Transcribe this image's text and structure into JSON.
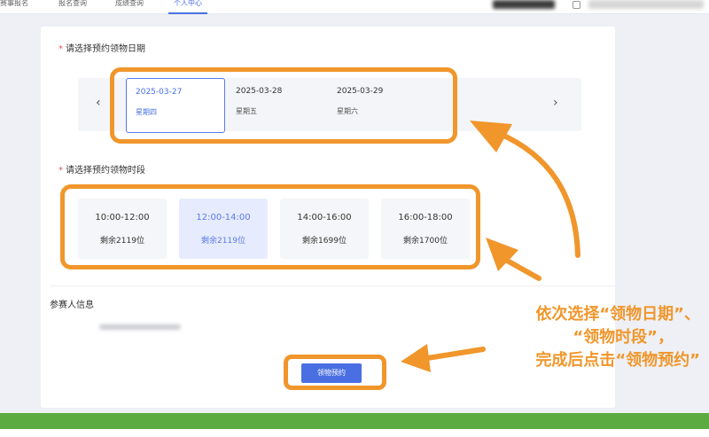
{
  "nav": {
    "tabs": [
      "赛事报名",
      "报名查询",
      "成绩查询",
      "个人中心"
    ],
    "active_index": 3
  },
  "date_section": {
    "label": "请选择预约领物日期",
    "dates": [
      {
        "date": "2025-03-27",
        "weekday": "星期四",
        "selected": true
      },
      {
        "date": "2025-03-28",
        "weekday": "星期五",
        "selected": false
      },
      {
        "date": "2025-03-29",
        "weekday": "星期六",
        "selected": false
      }
    ],
    "prev": "‹",
    "next": "›"
  },
  "time_section": {
    "label": "请选择预约领物时段",
    "slots": [
      {
        "time": "10:00-12:00",
        "remain": "剩余2119位",
        "selected": false
      },
      {
        "time": "12:00-14:00",
        "remain": "剩余2119位",
        "selected": true
      },
      {
        "time": "14:00-16:00",
        "remain": "剩余1699位",
        "selected": false
      },
      {
        "time": "16:00-18:00",
        "remain": "剩余1700位",
        "selected": false
      }
    ]
  },
  "participant": {
    "label": "参赛人信息"
  },
  "submit_label": "领物预约",
  "required_mark": "*",
  "annotation": {
    "line1": "依次选择“领物日期”、",
    "line2": "“领物时段”，",
    "line3": "完成后点击“领物预约”"
  },
  "colors": {
    "accent": "#4a6fe3",
    "highlight": "#f0962b",
    "footer": "#5cab41"
  }
}
